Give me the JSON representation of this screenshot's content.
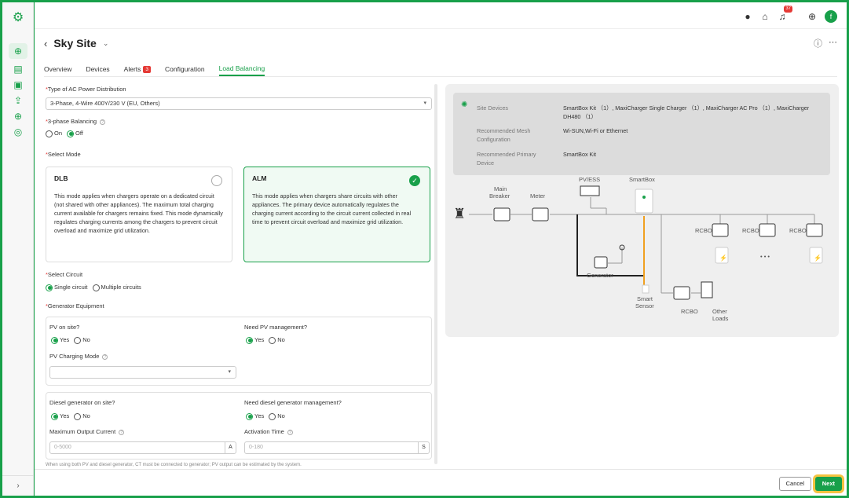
{
  "app": {
    "user_initial": "f",
    "notif_count": "37"
  },
  "page": {
    "title": "Sky Site"
  },
  "tabs": [
    {
      "label": "Overview"
    },
    {
      "label": "Devices"
    },
    {
      "label": "Alerts",
      "badge": "3"
    },
    {
      "label": "Configuration"
    },
    {
      "label": "Load Balancing"
    }
  ],
  "form": {
    "ac_power": {
      "label": "Type of AC Power Distribution",
      "value": "3-Phase, 4-Wire 400Y/230 V (EU, Others)"
    },
    "phase_balancing": {
      "label": "3-phase Balancing",
      "on": "On",
      "off": "Off",
      "selected": "Off"
    },
    "select_mode": {
      "label": "Select Mode"
    },
    "modes": [
      {
        "title": "DLB",
        "desc": "This mode applies when chargers operate on a dedicated circuit (not shared with other appliances). The maximum total charging current available for chargers remains fixed. This mode dynamically regulates charging currents among the chargers to prevent circuit overload and maximize grid utilization.",
        "selected": false
      },
      {
        "title": "ALM",
        "desc": "This mode applies when chargers share circuits with other appliances. The primary device automatically regulates the charging current according to the circuit current collected in real time to prevent circuit overload and maximize grid utilization.",
        "selected": true
      }
    ],
    "select_circuit": {
      "label": "Select Circuit",
      "single": "Single circuit",
      "multiple": "Multiple circuits",
      "selected": "Single circuit"
    },
    "generator_equipment": {
      "label": "Generator Equipment"
    },
    "pv_on_site": {
      "label": "PV on site?",
      "yes": "Yes",
      "no": "No",
      "selected": "Yes"
    },
    "pv_management": {
      "label": "Need PV management?",
      "yes": "Yes",
      "no": "No",
      "selected": "Yes"
    },
    "pv_charging_mode": {
      "label": "PV Charging Mode",
      "value": ""
    },
    "diesel_on_site": {
      "label": "Diesel generator on site?",
      "yes": "Yes",
      "no": "No",
      "selected": "Yes"
    },
    "diesel_management": {
      "label": "Need diesel generator management?",
      "yes": "Yes",
      "no": "No",
      "selected": "Yes"
    },
    "max_output": {
      "label": "Maximum Output Current",
      "placeholder": "0-5000",
      "unit": "A"
    },
    "activation_time": {
      "label": "Activation Time",
      "placeholder": "0-180",
      "unit": "S"
    },
    "note": "When using both PV and diesel generator, CT must be connected to generator; PV output can be estimated by the system."
  },
  "info": {
    "rows": [
      {
        "label": "Site Devices",
        "value": "SmartBox Kit （1）, MaxiCharger Single Charger （1）, MaxiCharger AC Pro （1）, MaxiCharger DH480 （1）"
      },
      {
        "label": "Recommended Mesh Configuration",
        "value": "Wi-SUN,Wi-Fi or Ethernet"
      },
      {
        "label": "Recommended Primary Device",
        "value": "SmartBox Kit"
      }
    ]
  },
  "diagram": {
    "main_breaker_1": "Main",
    "main_breaker_2": "Breaker",
    "meter": "Meter",
    "pv_ess": "PV/ESS",
    "smartbox": "SmartBox",
    "generator": "Generator",
    "smart_sensor_1": "Smart",
    "smart_sensor_2": "Sensor",
    "rcbo": "RCBO",
    "other_loads_1": "Other",
    "other_loads_2": "Loads",
    "ellipsis": "• • •"
  },
  "footer": {
    "cancel": "Cancel",
    "next": "Next"
  },
  "colors": {
    "accent": "#18a04a",
    "alert": "#e53935",
    "highlight": "#f5c440",
    "sensor_line": "#f0a020"
  }
}
